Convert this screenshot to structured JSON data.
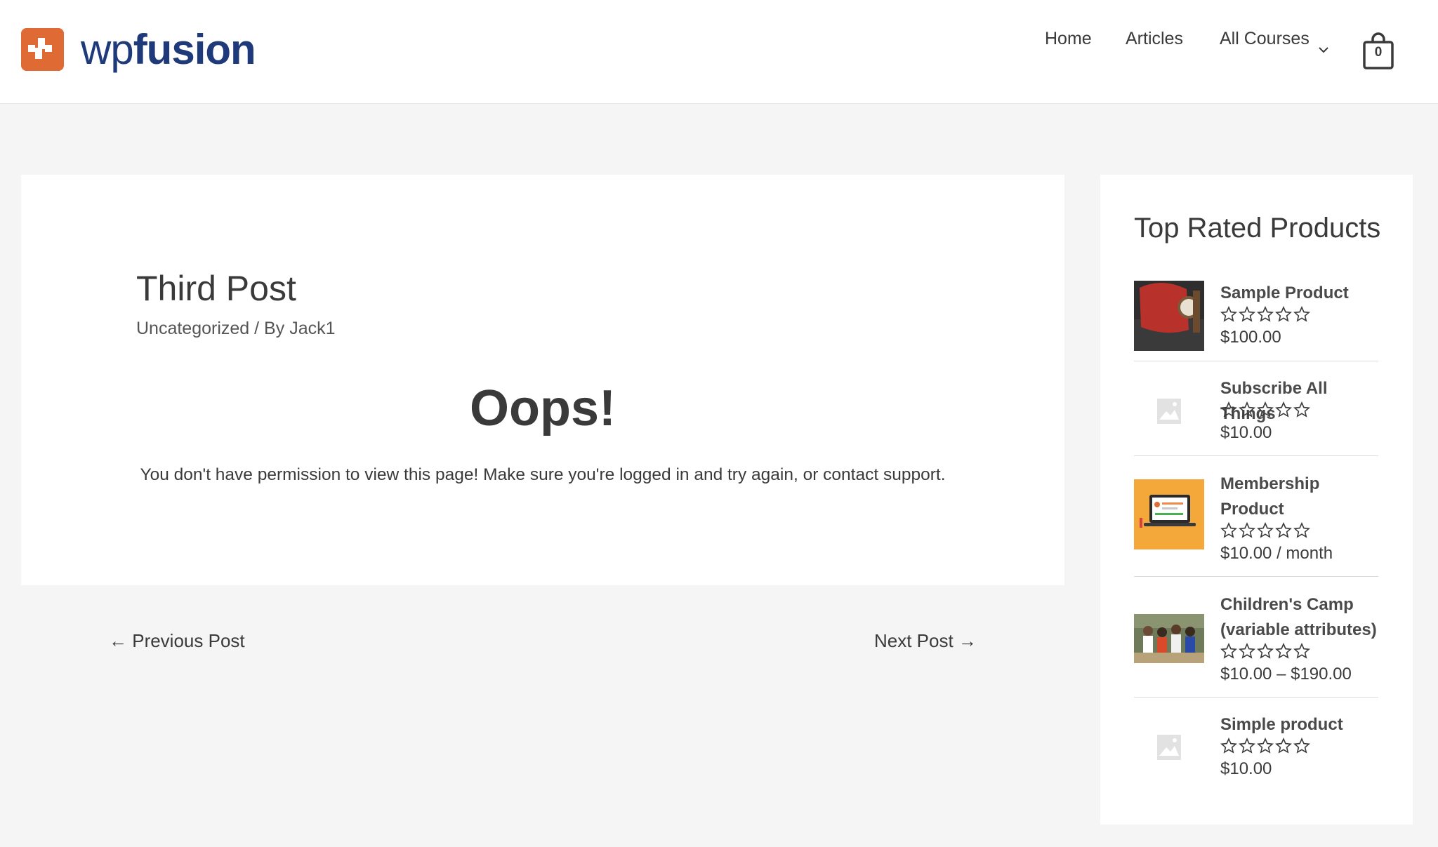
{
  "header": {
    "logo": {
      "wp": "wp",
      "fusion": "fusion",
      "accent_color": "#e06a34",
      "text_color": "#1f3a7a"
    },
    "nav": {
      "home": "Home",
      "articles": "Articles",
      "all_courses": "All Courses"
    },
    "cart_count": "0"
  },
  "post": {
    "title": "Third Post",
    "category": "Uncategorized",
    "separator": " / By ",
    "author": "Jack1",
    "oops": "Oops!",
    "message": "You don't have permission to view this page! Make sure you're logged in and try again, or contact support."
  },
  "post_nav": {
    "previous": "← Previous Post",
    "next": "Next Post →"
  },
  "sidebar": {
    "title": "Top Rated Products",
    "products": [
      {
        "name": "Sample Product",
        "price": "$100.00",
        "rating": 0,
        "thumb": "watch-bag-photo"
      },
      {
        "name": "Subscribe All Things",
        "price": "$10.00",
        "rating": 0,
        "thumb": "placeholder-image"
      },
      {
        "name": "Membership Product",
        "price": "$10.00 / month",
        "rating": 0,
        "thumb": "laptop-illustration"
      },
      {
        "name": "Children's Camp (variable attributes)",
        "price": "$10.00 – $190.00",
        "rating": 0,
        "thumb": "camp-photo"
      },
      {
        "name": "Simple product",
        "price": "$10.00",
        "rating": 0,
        "thumb": "placeholder-image"
      }
    ]
  }
}
